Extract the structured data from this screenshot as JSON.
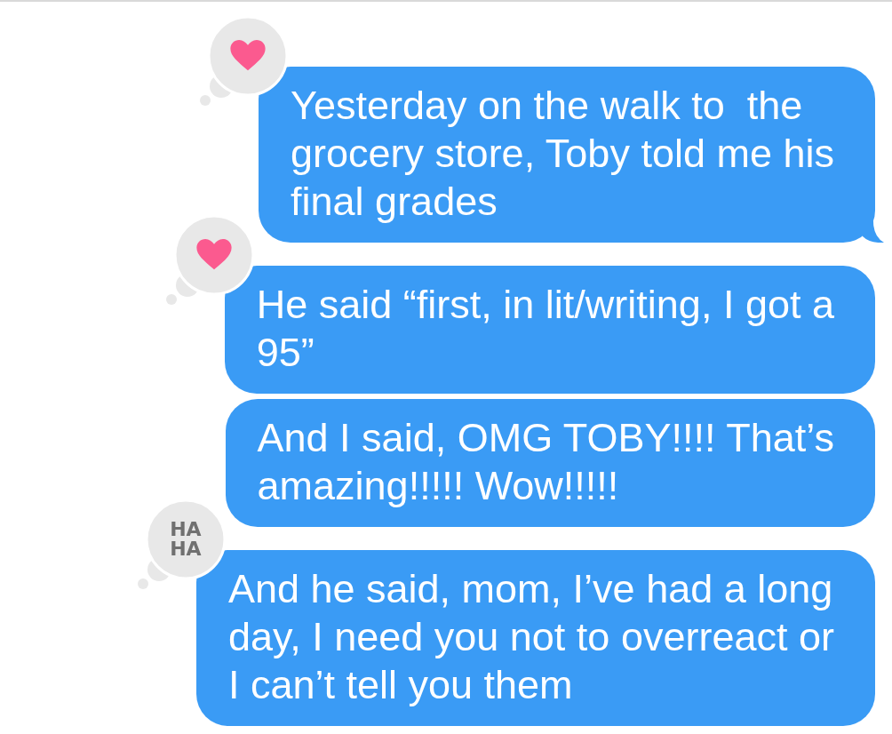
{
  "messages": [
    {
      "text": "Yesterday on the walk to  the\ngrocery store, Toby told me his\nfinal grades",
      "tail": true,
      "tapback": {
        "kind": "heart"
      }
    },
    {
      "text": "He said “first, in lit/writing, I got a\n95”",
      "tail": false,
      "tapback": {
        "kind": "heart"
      }
    },
    {
      "text": "And I said, OMG TOBY!!!! That’s\namazing!!!!! Wow!!!!!",
      "tail": false
    },
    {
      "text": "And he said, mom, I’ve had a long\nday, I need you not to overreact or\nI can’t tell you them",
      "tail": false,
      "tapback": {
        "kind": "haha",
        "lines": [
          "HA",
          "HA"
        ]
      }
    }
  ]
}
